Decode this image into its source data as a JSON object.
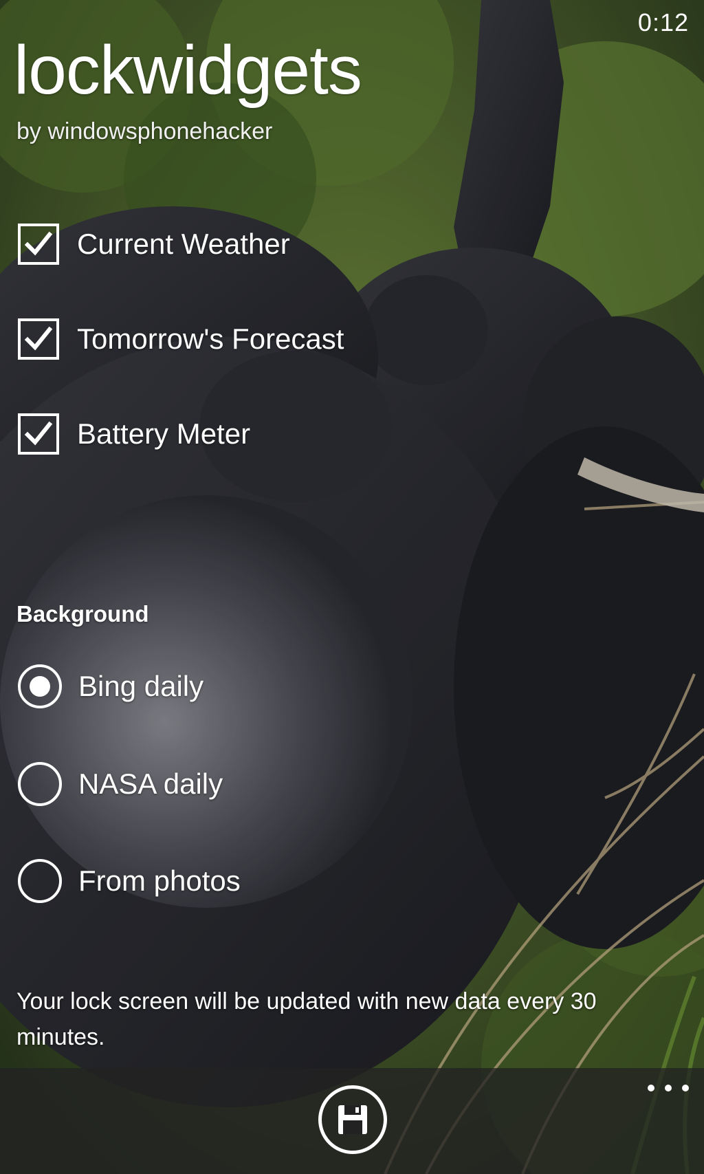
{
  "status_bar": {
    "time": "0:12"
  },
  "header": {
    "title": "lockwidgets",
    "subtitle": "by windowsphonehacker"
  },
  "widgets": [
    {
      "label": "Current Weather",
      "checked": true
    },
    {
      "label": "Tomorrow's Forecast",
      "checked": true
    },
    {
      "label": "Battery Meter",
      "checked": true
    }
  ],
  "background_section": {
    "header": "Background",
    "options": [
      {
        "label": "Bing daily",
        "selected": true
      },
      {
        "label": "NASA daily",
        "selected": false
      },
      {
        "label": "From photos",
        "selected": false
      }
    ]
  },
  "info": {
    "text": "Your lock screen will be updated with new data every 30 minutes."
  },
  "app_bar": {
    "save_icon": "save-floppy-icon",
    "more_icon": "ellipsis-icon"
  },
  "colors": {
    "foreground": "#ffffff",
    "app_bar_background": "#222222"
  }
}
